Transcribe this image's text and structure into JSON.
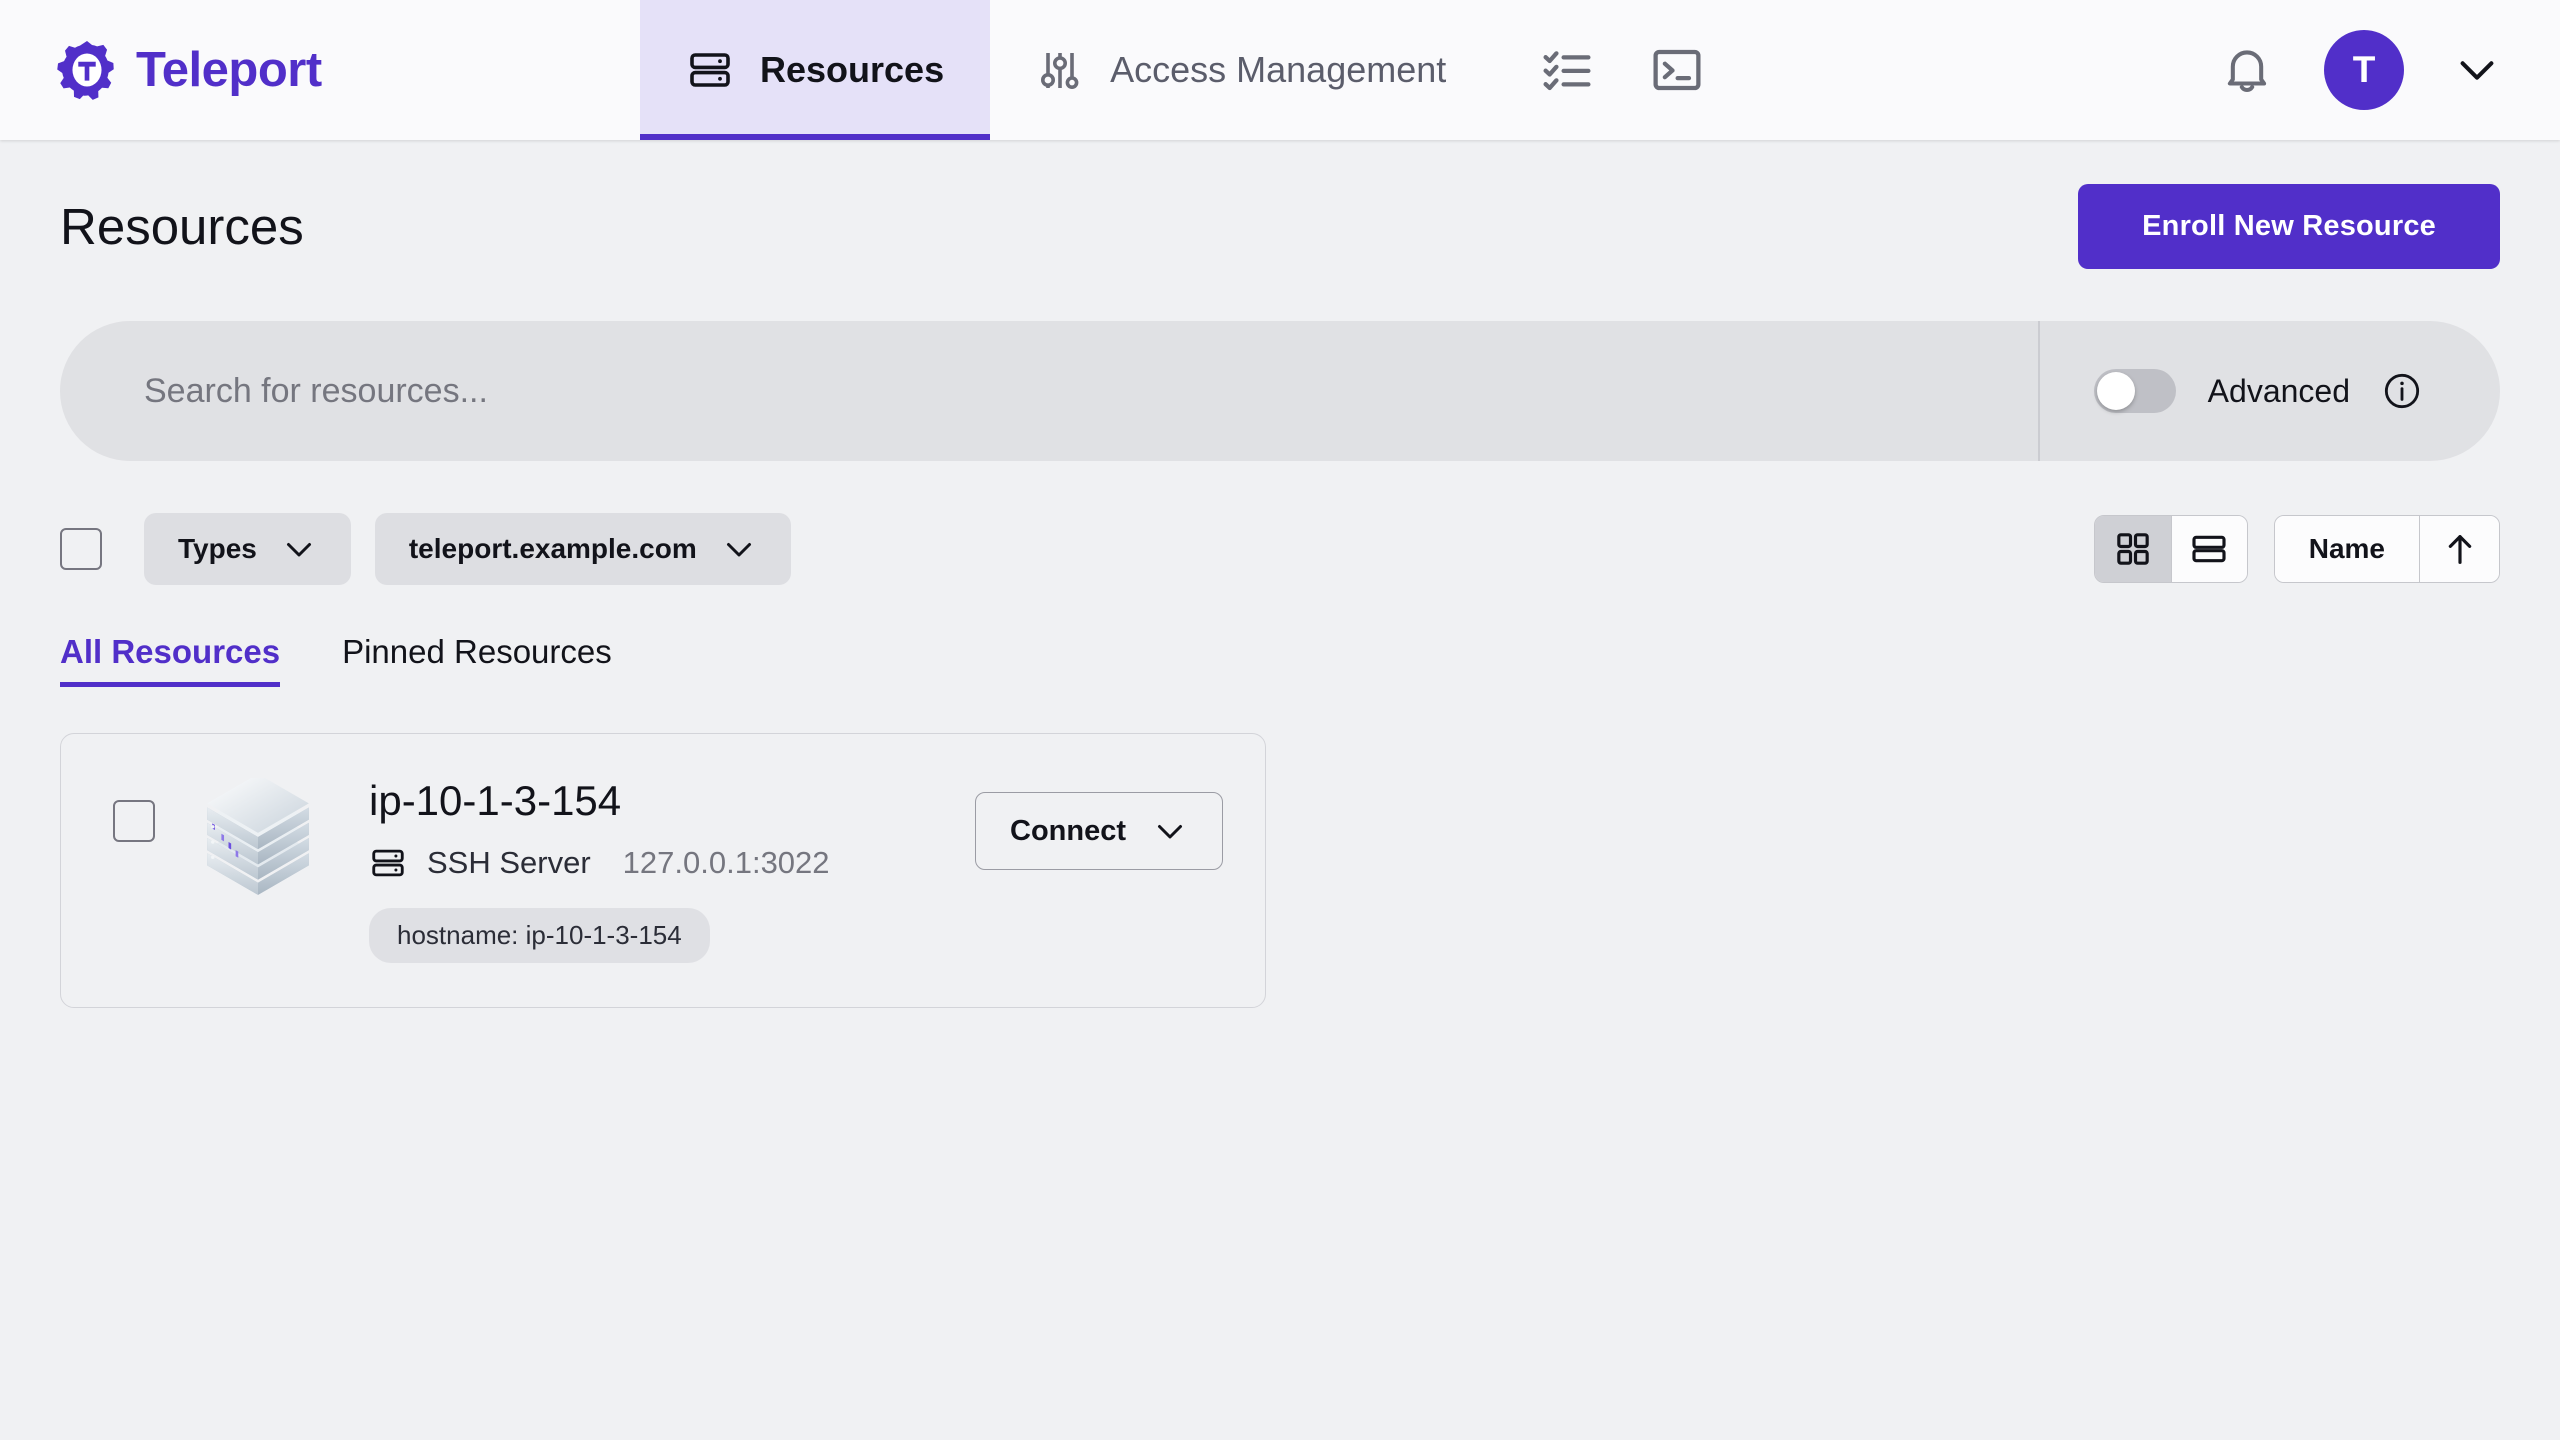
{
  "brand": {
    "name": "Teleport",
    "logo_icon": "teleport-gear-logo"
  },
  "nav": {
    "tabs": [
      {
        "label": "Resources",
        "icon": "server-rack-icon",
        "active": true
      },
      {
        "label": "Access Management",
        "icon": "sliders-icon",
        "active": false
      }
    ],
    "icon_buttons": [
      {
        "name": "checklist-icon"
      },
      {
        "name": "terminal-icon"
      }
    ],
    "right": {
      "notifications_icon": "bell-icon",
      "avatar_initial": "T",
      "avatar_color": "#512FC9",
      "menu_icon": "chevron-down-icon"
    }
  },
  "header": {
    "title": "Resources",
    "enroll_button": "Enroll New Resource"
  },
  "search": {
    "placeholder": "Search for resources...",
    "value": "",
    "advanced_label": "Advanced",
    "advanced_enabled": false,
    "info_icon": "info-circle-icon"
  },
  "filters": {
    "select_all_checked": false,
    "types_label": "Types",
    "cluster_label": "teleport.example.com",
    "view_grid_icon": "grid-view-icon",
    "view_list_icon": "list-view-icon",
    "view_active": "grid",
    "sort_label": "Name",
    "sort_direction_icon": "arrow-up-icon"
  },
  "tabs": [
    {
      "label": "All Resources",
      "active": true
    },
    {
      "label": "Pinned Resources",
      "active": false
    }
  ],
  "resources": [
    {
      "checked": false,
      "icon": "server-stack-3d-icon",
      "name": "ip-10-1-3-154",
      "kind_icon": "server-rack-icon",
      "kind": "SSH Server",
      "address": "127.0.0.1:3022",
      "tag": "hostname: ip-10-1-3-154",
      "action_label": "Connect",
      "action_icon": "chevron-down-icon"
    }
  ],
  "colors": {
    "brand_purple": "#512FC9",
    "active_tab_bg": "#E5E1F8",
    "page_bg": "#F0F1F3",
    "nav_bg": "#FAFAFC"
  }
}
